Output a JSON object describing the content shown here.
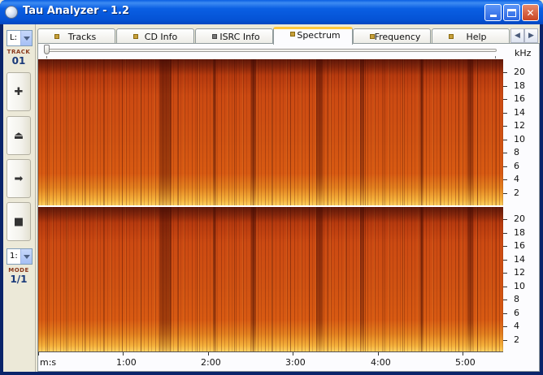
{
  "window": {
    "title": "Tau Analyzer - 1.2",
    "controls": {
      "minimize_icon": "minimize-icon",
      "maximize_icon": "maximize-icon",
      "close_icon": "close-icon"
    }
  },
  "left_panel": {
    "channel_select": "L:",
    "track_label": "TRACK",
    "track_number": "01",
    "buttons": [
      {
        "name": "add-button",
        "icon": "plus-icon",
        "glyph": "+"
      },
      {
        "name": "eject-button",
        "icon": "eject-icon",
        "glyph": "⏏"
      },
      {
        "name": "forward-button",
        "icon": "arrow-right-icon",
        "glyph": "➡"
      },
      {
        "name": "stop-button",
        "icon": "stop-icon",
        "glyph": "■"
      }
    ],
    "mode_select": "1:",
    "mode_label": "MODE",
    "mode_value": "1/1"
  },
  "tabs": [
    {
      "label": "Tracks"
    },
    {
      "label": "CD Info"
    },
    {
      "label": "ISRC Info"
    },
    {
      "label": "Spectrum",
      "active": true
    },
    {
      "label": "Frequency"
    },
    {
      "label": "Help"
    }
  ],
  "spectrum": {
    "unit": "kHz",
    "y_ticks": [
      "20",
      "18",
      "16",
      "14",
      "12",
      "10",
      "8",
      "6",
      "4",
      "2"
    ],
    "x_ticks": [
      "m:s",
      "1:00",
      "2:00",
      "3:00",
      "4:00",
      "5:00"
    ],
    "colors": {
      "low": "#fdd060",
      "mid": "#d05212",
      "high": "#832a0e"
    }
  }
}
